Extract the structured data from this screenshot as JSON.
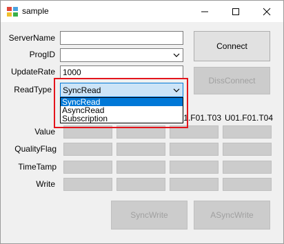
{
  "window": {
    "title": "sample"
  },
  "form": {
    "server_name_label": "ServerName",
    "server_name_value": "",
    "prog_id_label": "ProgID",
    "prog_id_value": "",
    "update_rate_label": "UpdateRate",
    "update_rate_value": "1000",
    "read_type_label": "ReadType",
    "read_type_value": "SyncRead",
    "read_type_options": [
      "SyncRead",
      "AsyncRead",
      "Subscription"
    ]
  },
  "buttons": {
    "connect": "Connect",
    "disconnect": "DissConnect",
    "sync_write": "SyncWrite",
    "async_write": "ASyncWrite"
  },
  "grid": {
    "column_headers": [
      "",
      "",
      "U01.F01.T03",
      "U01.F01.T04"
    ],
    "row_labels": [
      "Value",
      "QualityFlag",
      "TimeTamp",
      "Write"
    ]
  },
  "colors": {
    "highlight": "#e4141b",
    "selection": "#0078d7"
  }
}
